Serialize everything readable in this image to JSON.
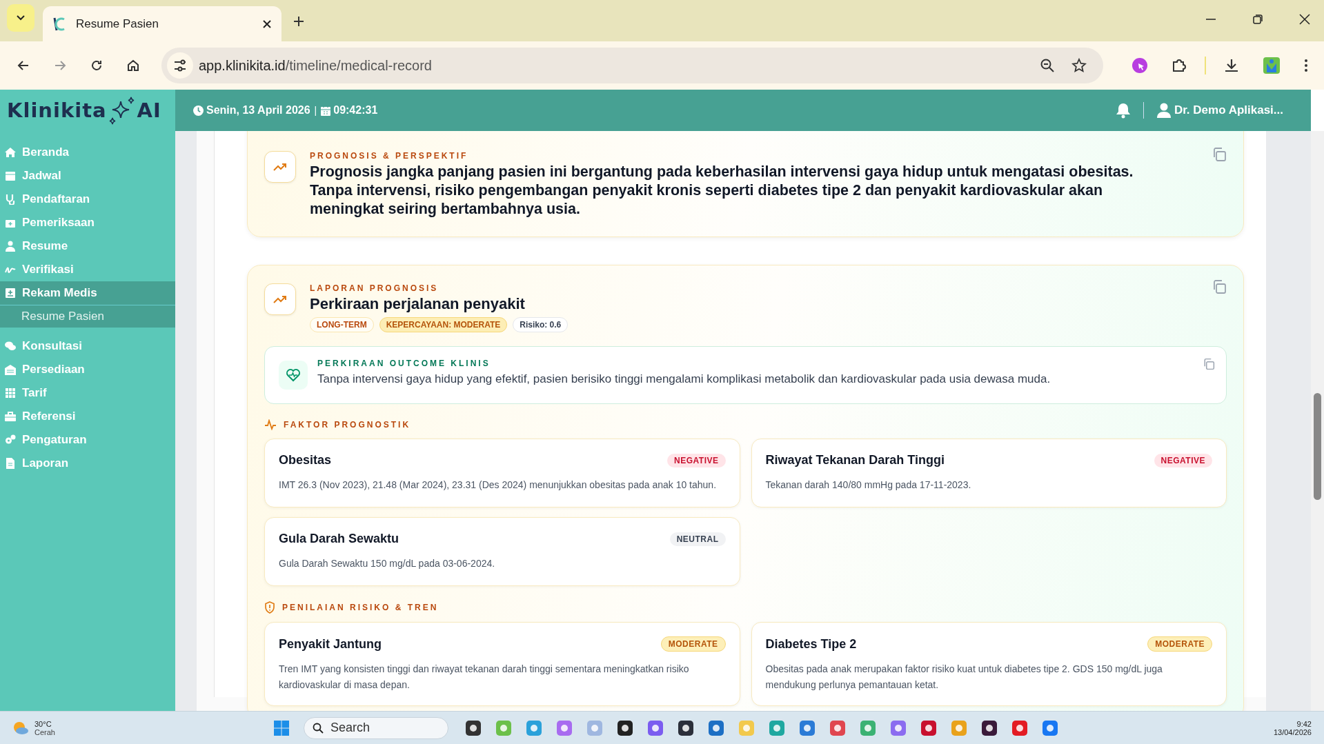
{
  "browser": {
    "tab_title": "Resume Pasien",
    "url_domain": "app.klinikita.id",
    "url_path": "/timeline/medical-record"
  },
  "header": {
    "logo": "Klinikita",
    "logo_suffix": "AI",
    "date": "Senin, 13 April 2026",
    "separator": "|",
    "time": "09:42:31",
    "user": "Dr. Demo Aplikasi..."
  },
  "sidebar": {
    "items": [
      {
        "label": "Beranda",
        "selected": false
      },
      {
        "label": "Jadwal",
        "selected": false
      },
      {
        "label": "Pendaftaran",
        "selected": false
      },
      {
        "label": "Pemeriksaan",
        "selected": false
      },
      {
        "label": "Resume",
        "selected": false
      },
      {
        "label": "Verifikasi",
        "selected": false
      },
      {
        "label": "Rekam Medis",
        "selected": true,
        "children": [
          {
            "label": "Resume Pasien",
            "selected": true
          }
        ]
      },
      {
        "label": "Konsultasi",
        "selected": false
      },
      {
        "label": "Persediaan",
        "selected": false
      },
      {
        "label": "Tarif",
        "selected": false
      },
      {
        "label": "Referensi",
        "selected": false
      },
      {
        "label": "Pengaturan",
        "selected": false
      },
      {
        "label": "Laporan",
        "selected": false
      }
    ]
  },
  "prognosis": {
    "label": "PROGNOSIS & PERSPEKTIF",
    "text": "Prognosis jangka panjang pasien ini bergantung pada keberhasilan intervensi gaya hidup untuk mengatasi obesitas. Tanpa intervensi, risiko pengembangan penyakit kronis seperti diabetes tipe 2 dan penyakit kardiovaskular akan meningkat seiring bertambahnya usia."
  },
  "report": {
    "label": "LAPORAN PROGNOSIS",
    "title": "Perkiraan perjalanan penyakit",
    "tags": [
      {
        "text": "LONG-TERM",
        "kind": "term"
      },
      {
        "text": "KEPERCAYAAN: MODERATE",
        "kind": "confidence"
      },
      {
        "text": "Risiko: 0.6",
        "kind": "risk"
      }
    ],
    "outcome": {
      "label": "PERKIRAAN OUTCOME KLINIS",
      "text": "Tanpa intervensi gaya hidup yang efektif, pasien berisiko tinggi mengalami komplikasi metabolik dan kardiovaskular pada usia dewasa muda."
    },
    "factors": {
      "label": "FAKTOR PROGNOSTIK",
      "items": [
        {
          "title": "Obesitas",
          "badge": "NEGATIVE",
          "kind": "negative",
          "text": "IMT 26.3 (Nov 2023), 21.48 (Mar 2024), 23.31 (Des 2024) menunjukkan obesitas pada anak 10 tahun."
        },
        {
          "title": "Riwayat Tekanan Darah Tinggi",
          "badge": "NEGATIVE",
          "kind": "negative",
          "text": "Tekanan darah 140/80 mmHg pada 17-11-2023."
        },
        {
          "title": "Gula Darah Sewaktu",
          "badge": "NEUTRAL",
          "kind": "neutral",
          "text": "Gula Darah Sewaktu 150 mg/dL pada 03-06-2024."
        }
      ]
    },
    "risks": {
      "label": "PENILAIAN RISIKO & TREN",
      "items": [
        {
          "title": "Penyakit Jantung",
          "badge": "MODERATE",
          "kind": "moderate",
          "text": "Tren IMT yang konsisten tinggi dan riwayat tekanan darah tinggi sementara meningkatkan risiko kardiovaskular di masa depan."
        },
        {
          "title": "Diabetes Tipe 2",
          "badge": "MODERATE",
          "kind": "moderate",
          "text": "Obesitas pada anak merupakan faktor risiko kuat untuk diabetes tipe 2. GDS 150 mg/dL juga mendukung perlunya pemantauan ketat."
        }
      ]
    }
  },
  "taskbar": {
    "temperature": "30°C",
    "weather": "Cerah",
    "search_placeholder": "Search",
    "time": "9:42",
    "date": "13/04/2026"
  }
}
